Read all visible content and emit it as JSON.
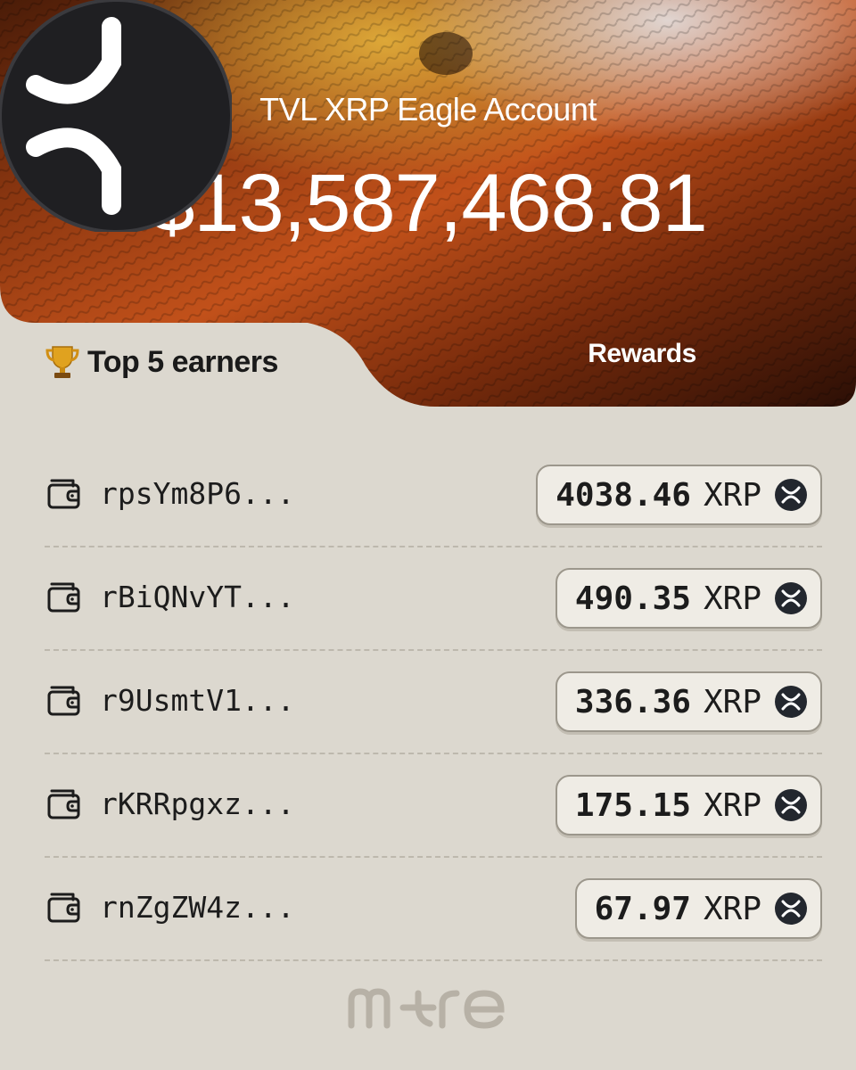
{
  "header": {
    "title": "TVL XRP Eagle Account",
    "amount": "$13,587,468.81"
  },
  "tabs": {
    "top_earners": "Top 5 earners",
    "rewards": "Rewards"
  },
  "earners": [
    {
      "address": "rpsYm8P6...",
      "amount": "4038.46",
      "unit": "XRP"
    },
    {
      "address": "rBiQNvYT...",
      "amount": "490.35",
      "unit": "XRP"
    },
    {
      "address": "r9UsmtV1...",
      "amount": "336.36",
      "unit": "XRP"
    },
    {
      "address": "rKRRpgxz...",
      "amount": "175.15",
      "unit": "XRP"
    },
    {
      "address": "rnZgZW4z...",
      "amount": "67.97",
      "unit": "XRP"
    }
  ],
  "icons": {
    "wallet": "wallet-icon",
    "coin": "xrp-coin-icon",
    "trophy": "trophy-icon"
  },
  "colors": {
    "background": "#dcd8cf",
    "pill_bg": "#efece5",
    "text": "#1c1c1c",
    "hero_accent": "#c2410c"
  },
  "brand": {
    "wordmark": "m+re"
  }
}
